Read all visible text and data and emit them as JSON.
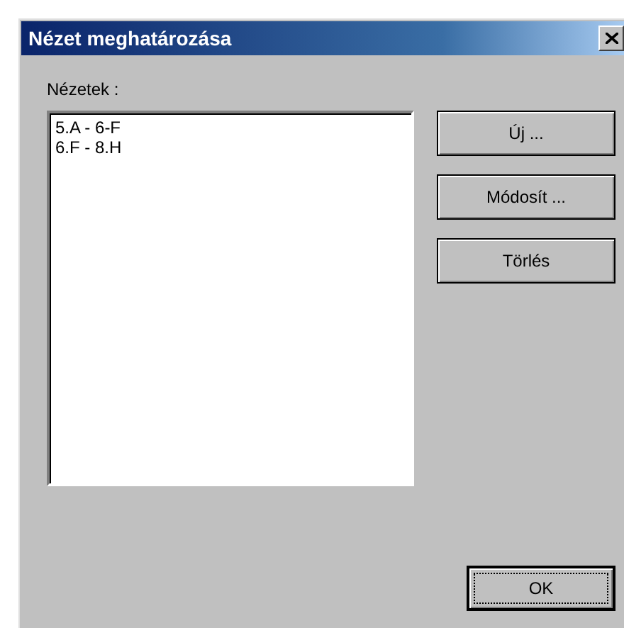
{
  "window": {
    "title": "Nézet meghatározása"
  },
  "views_label": "Nézetek :",
  "views": [
    {
      "label": "5.A - 6-F",
      "selected": false
    },
    {
      "label": "6.F - 8.H",
      "selected": false
    }
  ],
  "side_buttons": [
    {
      "label": "Új ...",
      "focused": false
    },
    {
      "label": "Módosít ...",
      "focused": false
    },
    {
      "label": "Törlés",
      "focused": false
    }
  ],
  "ok_button": {
    "label": "OK",
    "focused": true
  }
}
